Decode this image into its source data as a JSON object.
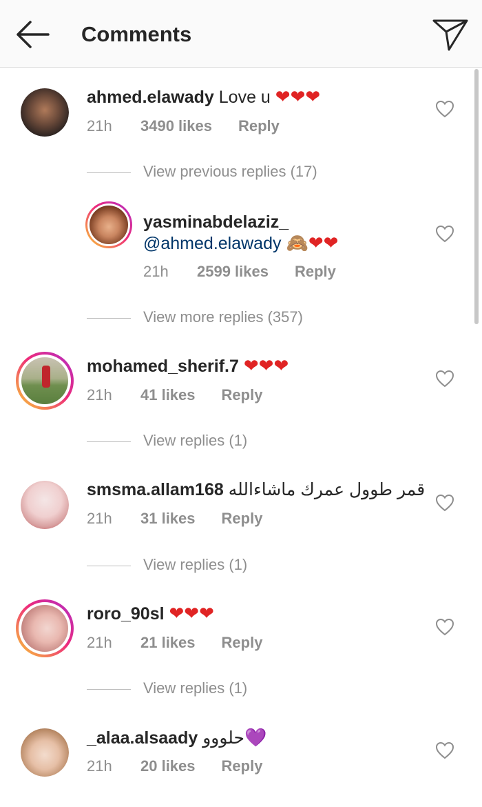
{
  "header": {
    "title": "Comments",
    "back_icon": "arrow-left-icon",
    "send_icon": "paper-plane-icon"
  },
  "comments": [
    {
      "username": "ahmed.elawady",
      "text": "Love u",
      "emojis": "❤❤❤",
      "time": "21h",
      "likes": "3490 likes",
      "reply": "Reply",
      "view_replies": "View previous replies (17)"
    },
    {
      "username": "yasminabdelaziz_",
      "mention": "@ahmed.elawady",
      "emojis": "🙈❤❤",
      "time": "21h",
      "likes": "2599 likes",
      "reply": "Reply",
      "view_replies": "View more replies (357)"
    },
    {
      "username": "mohamed_sherif.7",
      "emojis": "❤❤❤",
      "time": "21h",
      "likes": "41 likes",
      "reply": "Reply",
      "view_replies": "View replies (1)"
    },
    {
      "username": "smsma.allam168",
      "text": "قمر طوول عمرك ماشاءالله",
      "time": "21h",
      "likes": "31 likes",
      "reply": "Reply",
      "view_replies": "View replies (1)"
    },
    {
      "username": "roro_90sl",
      "emojis": "❤❤❤",
      "time": "21h",
      "likes": "21 likes",
      "reply": "Reply",
      "view_replies": "View replies (1)"
    },
    {
      "username": "_alaa.alsaady",
      "text": "حلووو",
      "emojis": "💜",
      "time": "21h",
      "likes": "20 likes",
      "reply": "Reply"
    }
  ],
  "colors": {
    "accent_ring": "#ee2a7b",
    "heart": "#e02424",
    "mention": "#003569",
    "meta": "#8e8e8e"
  }
}
